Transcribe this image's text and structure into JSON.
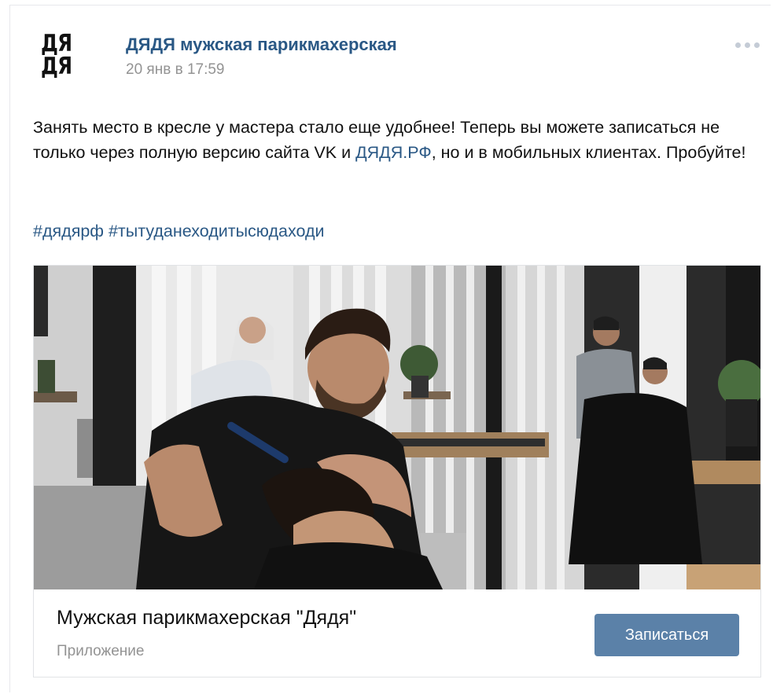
{
  "post": {
    "logo_top": "ДЯ",
    "logo_bottom": "ДЯ",
    "author": "ДЯДЯ мужская парикмахерская",
    "date": "20 янв в 17:59",
    "text_part1": "Занять место в кресле у мастера стало еще удобнее! Теперь вы можете записаться не только через полную версию сайта VK и ",
    "text_link": "ДЯДЯ.РФ",
    "text_part2": ", но и в мобильных клиентах. Пробуйте!",
    "hashtag1": "#дядярф",
    "hashtag2": "#тытуданеходитысюдаходи"
  },
  "card": {
    "title": "Мужская парикмахерская \"Дядя\"",
    "subtitle": "Приложение",
    "button_label": "Записаться"
  },
  "colors": {
    "link": "#2a5885",
    "button": "#5b81a8",
    "muted": "#939393"
  },
  "icons": {
    "more": "more-dots-icon"
  }
}
